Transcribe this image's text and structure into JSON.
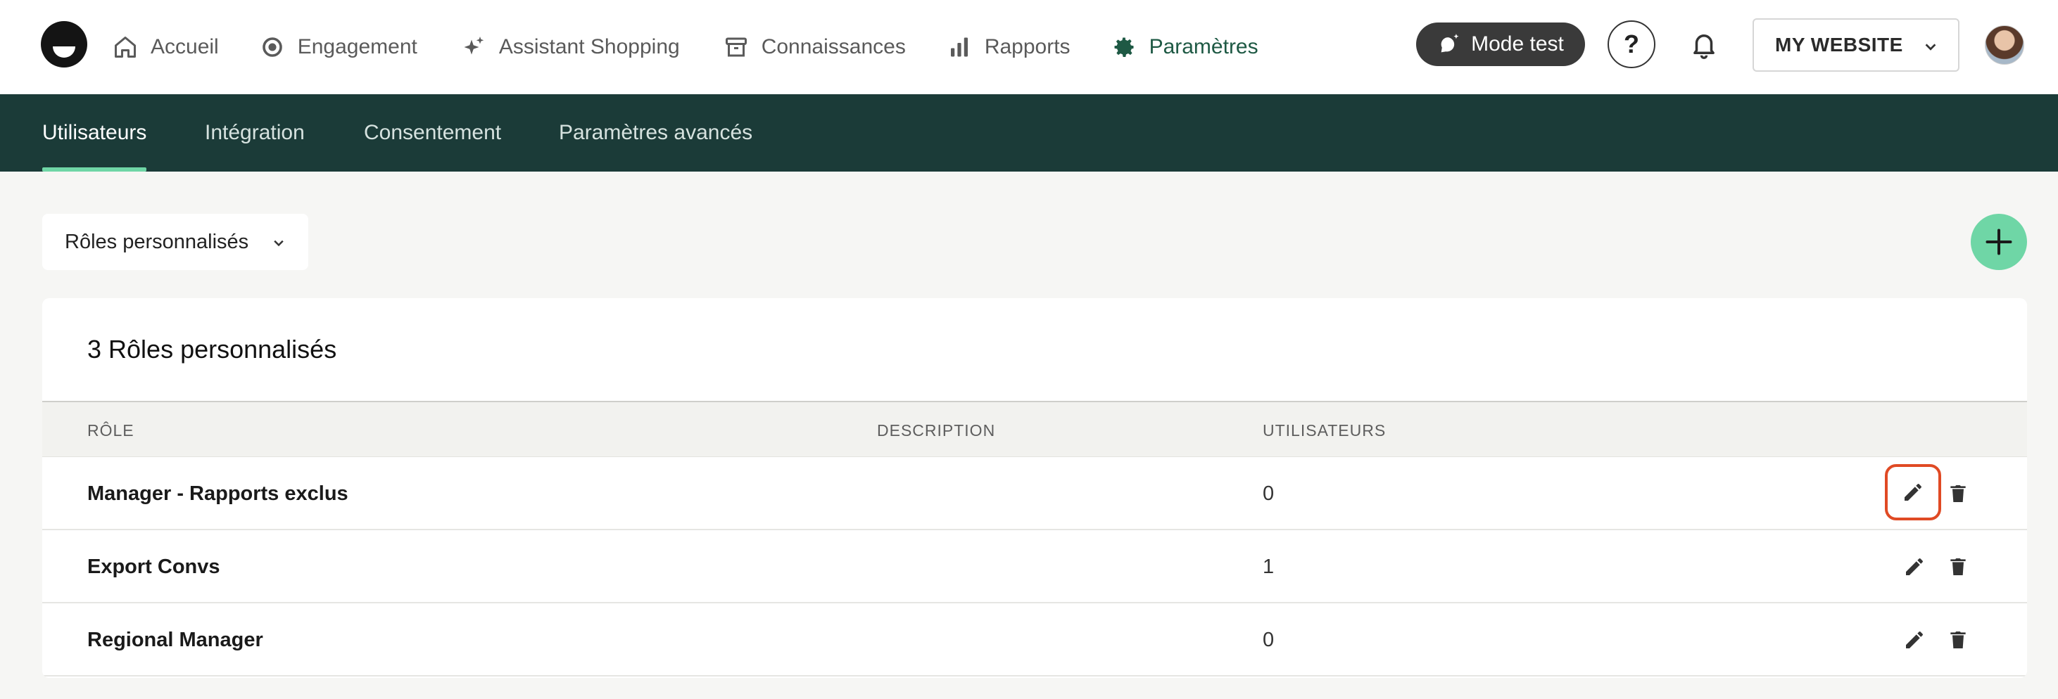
{
  "nav": {
    "items": [
      {
        "label": "Accueil",
        "icon": "home-icon",
        "active": false
      },
      {
        "label": "Engagement",
        "icon": "target-icon",
        "active": false
      },
      {
        "label": "Assistant Shopping",
        "icon": "sparkle-icon",
        "active": false
      },
      {
        "label": "Connaissances",
        "icon": "archive-icon",
        "active": false
      },
      {
        "label": "Rapports",
        "icon": "bar-chart-icon",
        "active": false
      },
      {
        "label": "Paramètres",
        "icon": "gear-icon",
        "active": true
      }
    ],
    "mode_test_label": "Mode test",
    "help_label": "?",
    "site_select_value": "MY WEBSITE"
  },
  "subnav": {
    "tabs": [
      {
        "label": "Utilisateurs",
        "active": true
      },
      {
        "label": "Intégration",
        "active": false
      },
      {
        "label": "Consentement",
        "active": false
      },
      {
        "label": "Paramètres avancés",
        "active": false
      }
    ]
  },
  "filter": {
    "selected": "Rôles personnalisés"
  },
  "roles_table": {
    "title": "3 Rôles personnalisés",
    "columns": [
      "RÔLE",
      "DESCRIPTION",
      "UTILISATEURS"
    ],
    "rows": [
      {
        "role": "Manager - Rapports exclus",
        "description": "",
        "users": "0"
      },
      {
        "role": "Export Convs",
        "description": "",
        "users": "1"
      },
      {
        "role": "Regional Manager",
        "description": "",
        "users": "0"
      }
    ]
  },
  "colors": {
    "brand_dark": "#1b3b38",
    "accent_green": "#6fd6a6",
    "active_nav": "#1e5944",
    "highlight": "#e04a24"
  }
}
